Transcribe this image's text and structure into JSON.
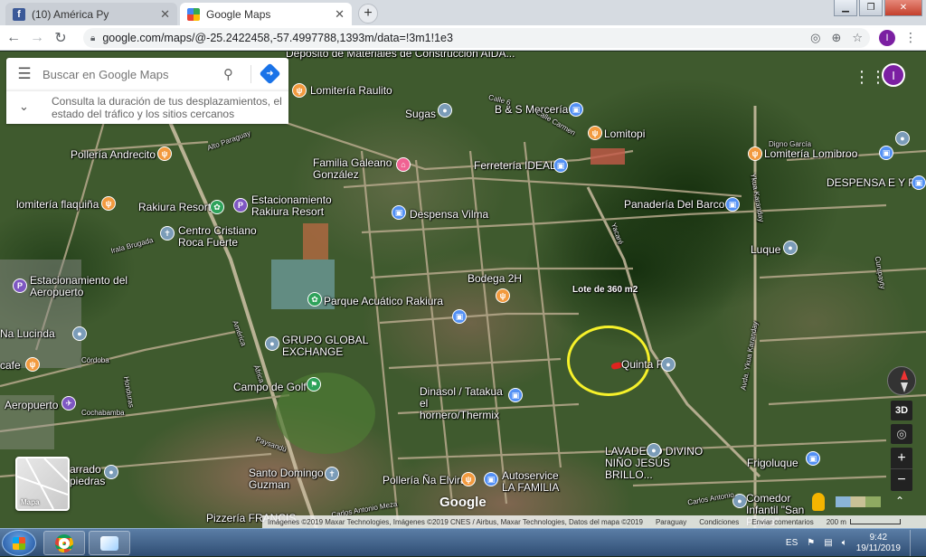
{
  "browser": {
    "tabs": [
      {
        "title": "(10) América Py",
        "favicon": "facebook-icon"
      },
      {
        "title": "Google Maps",
        "favicon": "google-maps-icon"
      }
    ],
    "new_tab": "+",
    "url": "google.com/maps/@-25.2422458,-57.4997788,1393m/data=!3m1!1e3",
    "profile_initial": "I"
  },
  "search": {
    "placeholder": "Buscar en Google Maps",
    "hint": "Consulta la duración de tus desplazamientos, el estado del tráfico y los sitios cercanos"
  },
  "account_initial": "I",
  "map_labels": {
    "construccion": "Depósito de Materiales de Construcción AIDA...",
    "raulito": "Lomitería Raulito",
    "sugas": "Sugas",
    "bs_merceria": "B & S Mercería",
    "lomitopi": "Lomitopi",
    "andrecito": "Pollería Andrecito",
    "galeano": "Familia Galeano González",
    "ideal": "Ferretería IDEAL",
    "lomibroo": "Lomitería Lomibroo",
    "despensa_ey": "DESPENSA E Y R",
    "flaquina": "lomitería flaquiña",
    "rakiura_resort": "Rakiura Resort",
    "estacionamiento_rakiura": "Estacionamiento Rakiura Resort",
    "vilma": "Despensa Vilma",
    "barco": "Panadería Del Barco",
    "cristiano": "Centro Cristiano Roca Fuerte",
    "luque": "Luque",
    "est_aeropuerto": "Estacionamiento del Aeropuerto",
    "bodega": "Bodega 2H",
    "lote": "Lote de 360 m2",
    "parque": "Parque Acuático Rakiura",
    "lucinda": "Na Lucinda",
    "grupo": "GRUPO GLOBAL EXCHANGE",
    "cafe": "cafe",
    "quinta": "Quinta F",
    "campo": "Campo de Golf",
    "aeropuerto": "Aeropuerto",
    "dinasol": "Dinasol / Tatakua el hornero/Thermix",
    "lavadero": "LAVADERO DIVINO NIÑO JESÚS BRILLO...",
    "arrado": "arrado piedras",
    "santo_domingo": "Santo Domingo de Guzman",
    "elvira": "Pollería Ña Elvira",
    "autoservice": "Autoservice LA FAMILIA",
    "frigoluque": "Frigoluque",
    "comedor": "Comedor Infantil \"San Pedro\"",
    "pizzeria": "Pizzería FRANCIS",
    "digno": "Digno García",
    "roads": {
      "alto_paraguay": "Alto Paraguay",
      "america": "América",
      "africa": "África",
      "yacare": "Yacaré",
      "avda_yrua": "Avda. Ykua Karanday",
      "ykua": "Ykua Karanday",
      "payaindu": "Paysandú",
      "cochabamba": "Cochabamba",
      "cordoba": "Córdoba",
      "honduras": "Honduras",
      "carlos_antonio": "Carlos Antonio Meza",
      "carlos_antonio_2": "Carlos Antonio",
      "calle_carmen": "Calle Carmen",
      "irala": "Irala Brugada",
      "curupay": "Curupayty",
      "calle_6": "Calle 6"
    }
  },
  "controls": {
    "minimap_label": "Mapa",
    "btn_3d": "3D",
    "zoom_in": "+",
    "zoom_out": "−",
    "google_logo": "Google"
  },
  "attribution": {
    "imagery": "Imágenes ©2019 Maxar Technologies, Imágenes ©2019 CNES / Airbus, Maxar Technologies, Datos del mapa ©2019",
    "country": "Paraguay",
    "terms": "Condiciones",
    "feedback": "Enviar comentarios",
    "scale": "200 m"
  },
  "taskbar": {
    "lang": "ES",
    "time": "9:42",
    "date": "19/11/2019"
  },
  "colors": {
    "highlight_ellipse": "#f6f12a",
    "lot_marker": "#e0231f",
    "accent": "#1a73e8"
  }
}
